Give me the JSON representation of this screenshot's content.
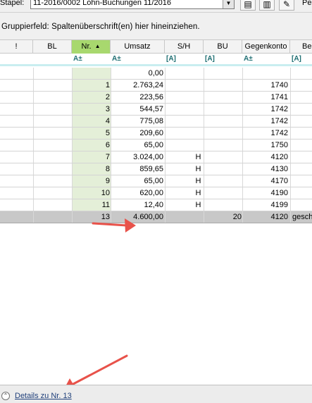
{
  "toolbar": {
    "stapel_label": "Stapel:",
    "stapel_value": "11-2016/0002 Lohn-Buchungen 11/2016",
    "extra_label": "Pe"
  },
  "group_panel": {
    "hint": "Gruppierfeld: Spaltenüberschrift(en) hier hineinziehen."
  },
  "columns": [
    {
      "key": "mark",
      "label": "!"
    },
    {
      "key": "bl",
      "label": "BL"
    },
    {
      "key": "nr",
      "label": "Nr."
    },
    {
      "key": "umsatz",
      "label": "Umsatz"
    },
    {
      "key": "sh",
      "label": "S/H"
    },
    {
      "key": "bu",
      "label": "BU"
    },
    {
      "key": "gegenkonto",
      "label": "Gegenkonto"
    },
    {
      "key": "be",
      "label": "Be"
    }
  ],
  "filter_row": {
    "nr": "A±",
    "umsatz": "A±",
    "sh": "[A]",
    "bu": "[A]",
    "gegenkonto": "A±",
    "be": "[A]"
  },
  "rows": [
    {
      "nr": "",
      "umsatz": "0,00",
      "sh": "",
      "bu": "",
      "gegenkonto": "",
      "be": ""
    },
    {
      "nr": "1",
      "umsatz": "2.763,24",
      "sh": "",
      "bu": "",
      "gegenkonto": "1740",
      "be": ""
    },
    {
      "nr": "2",
      "umsatz": "223,56",
      "sh": "",
      "bu": "",
      "gegenkonto": "1741",
      "be": ""
    },
    {
      "nr": "3",
      "umsatz": "544,57",
      "sh": "",
      "bu": "",
      "gegenkonto": "1742",
      "be": ""
    },
    {
      "nr": "4",
      "umsatz": "775,08",
      "sh": "",
      "bu": "",
      "gegenkonto": "1742",
      "be": ""
    },
    {
      "nr": "5",
      "umsatz": "209,60",
      "sh": "",
      "bu": "",
      "gegenkonto": "1742",
      "be": ""
    },
    {
      "nr": "6",
      "umsatz": "65,00",
      "sh": "",
      "bu": "",
      "gegenkonto": "1750",
      "be": ""
    },
    {
      "nr": "7",
      "umsatz": "3.024,00",
      "sh": "H",
      "bu": "",
      "gegenkonto": "4120",
      "be": ""
    },
    {
      "nr": "8",
      "umsatz": "859,65",
      "sh": "H",
      "bu": "",
      "gegenkonto": "4130",
      "be": ""
    },
    {
      "nr": "9",
      "umsatz": "65,00",
      "sh": "H",
      "bu": "",
      "gegenkonto": "4170",
      "be": ""
    },
    {
      "nr": "10",
      "umsatz": "620,00",
      "sh": "H",
      "bu": "",
      "gegenkonto": "4190",
      "be": ""
    },
    {
      "nr": "11",
      "umsatz": "12,40",
      "sh": "H",
      "bu": "",
      "gegenkonto": "4199",
      "be": ""
    },
    {
      "nr": "13",
      "umsatz": "4.600,00",
      "sh": "",
      "bu": "20",
      "gegenkonto": "4120",
      "be": "gesch",
      "selected": true
    }
  ],
  "footer": {
    "toggle_icon": "⌃",
    "details_label": "Details zu Nr. 13"
  },
  "colors": {
    "sorted_header": "#a8d86e",
    "nr_column": "#e4efd8",
    "selected_row": "#c8c8c8",
    "filter_underline": "#c9eef0",
    "annotation_arrow": "#e8524a"
  }
}
